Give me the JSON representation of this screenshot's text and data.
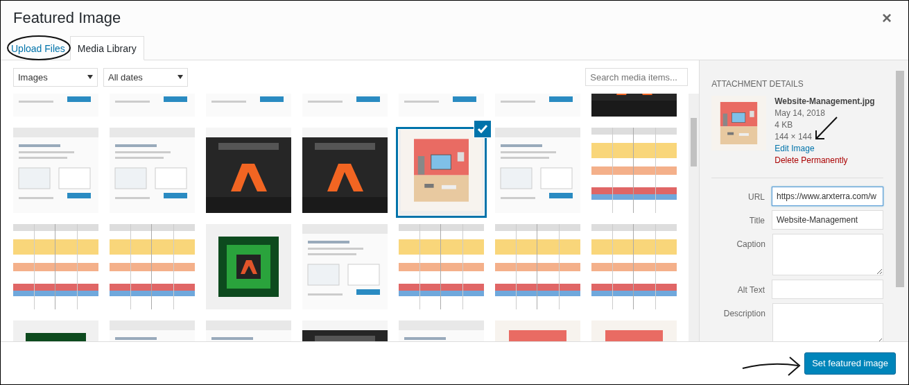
{
  "window": {
    "title": "Featured Image",
    "close": "×"
  },
  "tabs": [
    {
      "label": "Upload Files",
      "selected": false
    },
    {
      "label": "Media Library",
      "selected": true
    }
  ],
  "filters": [
    {
      "label": "Images"
    },
    {
      "label": "All dates"
    }
  ],
  "search": {
    "placeholder": "Search media items..."
  },
  "items": [
    {
      "kind": "picture",
      "selected": false
    },
    {
      "kind": "picture",
      "selected": false
    },
    {
      "kind": "picture",
      "selected": false
    },
    {
      "kind": "picture",
      "selected": false
    },
    {
      "kind": "picture",
      "selected": false
    },
    {
      "kind": "picture",
      "selected": false
    },
    {
      "kind": "picture",
      "selected": false
    },
    {
      "kind": "picture",
      "selected": false
    },
    {
      "kind": "picture",
      "selected": false
    },
    {
      "kind": "picture",
      "selected": false
    },
    {
      "kind": "picture",
      "selected": false
    },
    {
      "kind": "picture",
      "selected": true
    },
    {
      "kind": "picture",
      "selected": false
    },
    {
      "kind": "picture",
      "selected": false
    },
    {
      "kind": "picture",
      "selected": false
    },
    {
      "kind": "picture",
      "selected": false
    },
    {
      "kind": "picture",
      "selected": false
    },
    {
      "kind": "picture",
      "selected": false
    },
    {
      "kind": "picture",
      "selected": false
    },
    {
      "kind": "picture",
      "selected": false
    },
    {
      "kind": "picture",
      "selected": false
    },
    {
      "kind": "picture",
      "selected": false
    },
    {
      "kind": "picture",
      "selected": false
    },
    {
      "kind": "picture",
      "selected": false
    },
    {
      "kind": "picture",
      "selected": false
    },
    {
      "kind": "picture",
      "selected": false
    },
    {
      "kind": "picture",
      "selected": false
    },
    {
      "kind": "picture",
      "selected": false
    }
  ],
  "details": {
    "heading": "ATTACHMENT DETAILS",
    "filename": "Website-Management.jpg",
    "date": "May 14, 2018",
    "size": "4 KB",
    "dimensions": "144 × 144",
    "edit_link": "Edit Image",
    "delete_link": "Delete Permanently",
    "fields": [
      {
        "label": "URL",
        "kind": "input",
        "value": "https://www.arxterra.com/w"
      },
      {
        "label": "Title",
        "kind": "input",
        "value": "Website-Management"
      },
      {
        "label": "Caption",
        "kind": "textarea"
      },
      {
        "label": "Alt Text",
        "kind": "input"
      },
      {
        "label": "Description",
        "kind": "textarea"
      }
    ]
  },
  "button": {
    "label": "Set featured image"
  },
  "annotations": [
    {
      "kind": "circle"
    },
    {
      "kind": "arrow"
    },
    {
      "kind": "curved_arrow"
    }
  ]
}
